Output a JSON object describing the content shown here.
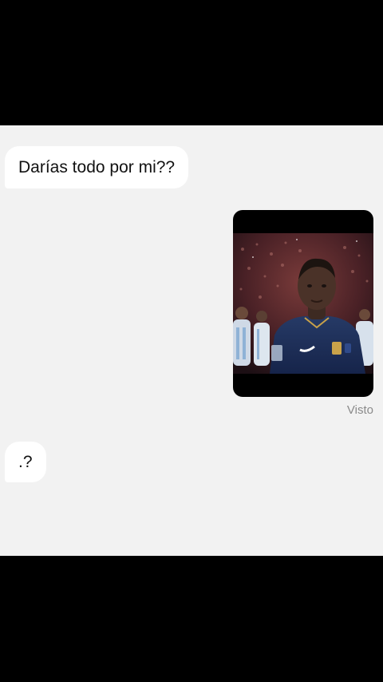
{
  "chat": {
    "messages": [
      {
        "direction": "incoming",
        "type": "text",
        "text": "Darías todo por mi??"
      },
      {
        "direction": "outgoing",
        "type": "media",
        "media": "video-thumbnail-footballer-in-stadium"
      },
      {
        "direction": "incoming",
        "type": "text",
        "text": ".?"
      }
    ],
    "status": "Visto"
  },
  "colors": {
    "background": "#f2f2f2",
    "bubble_incoming": "#ffffff",
    "text": "#111111",
    "status_text": "#8a8a8a",
    "frame": "#000000"
  }
}
